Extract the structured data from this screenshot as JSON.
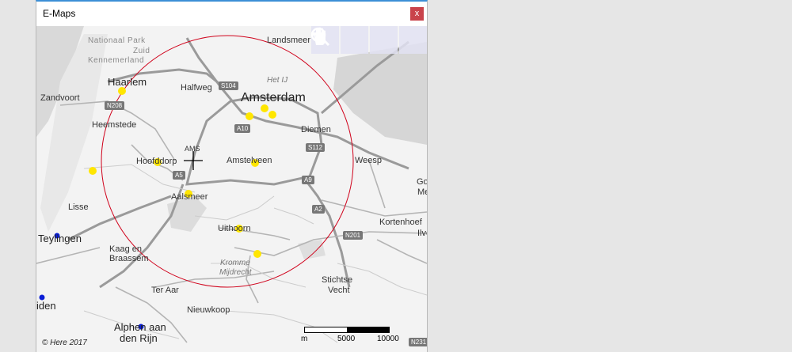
{
  "window": {
    "title": "E-Maps",
    "close_label": "x"
  },
  "colors": {
    "radius_circle": "#d0021b",
    "poi_primary": "#ffe600",
    "poi_secondary": "#0a1ed6",
    "close_button": "#c9434b"
  },
  "toolbar": {
    "buttons": [
      {
        "icon": "hand-pan-icon"
      },
      {
        "icon": "zoom-in-magnifier-icon"
      },
      {
        "icon": "plus-icon"
      },
      {
        "icon": "minus-icon"
      }
    ]
  },
  "map": {
    "center_code": "AMS",
    "labels": {
      "landsmeer": "Landsmeer",
      "nationaal_park": "Nationaal Park",
      "zuid": "Zuid",
      "kennemerland": "Kennemerland",
      "haarlem": "Haarlem",
      "halfweg": "Halfweg",
      "het_ij": "Het IJ",
      "amsterdam": "Amsterdam",
      "zandvoort": "Zandvoort",
      "heemstede": "Heemstede",
      "diemen": "Diemen",
      "weesp": "Weesp",
      "hoofddorp": "Hoofddorp",
      "amstelveen": "Amstelveen",
      "aalsmeer": "Aalsmeer",
      "lisse": "Lisse",
      "go": "Go",
      "me": "Me",
      "kortenhoef": "Kortenhoef",
      "uithoorn": "Uithoorn",
      "teylingen": "Teylingen",
      "kaag_en": "Kaag en",
      "braassem": "Braassem",
      "kromme": "Kromme",
      "mijdrecht": "Mijdrecht",
      "ilve": "Ilve",
      "stichtse": "Stichtse",
      "vecht": "Vecht",
      "ter_aar": "Ter Aar",
      "iden": "iden",
      "nieuwkoop": "Nieuwkoop",
      "alphen_aan": "Alphen aan",
      "den_rijn": "den Rijn"
    },
    "road_shields": {
      "n208": "N208",
      "s104": "S104",
      "a10": "A10",
      "s112": "S112",
      "a5": "A5",
      "a9": "A9",
      "a2": "A2",
      "n201": "N201",
      "n231": "N231"
    },
    "copyright": "© Here 2017",
    "scale": {
      "unit": "m",
      "mid": "5000",
      "end": "10000"
    }
  }
}
